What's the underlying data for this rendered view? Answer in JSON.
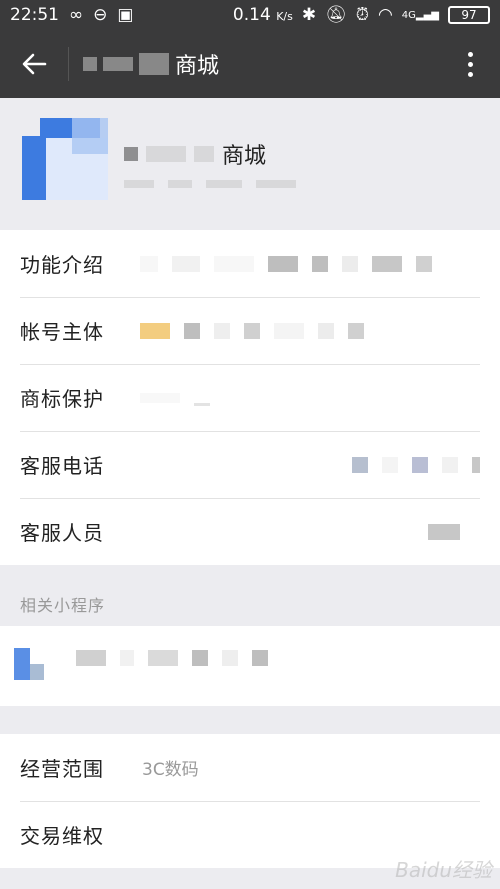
{
  "status_bar": {
    "time": "22:51",
    "speed": "0.14",
    "speed_unit": "K/s",
    "network": "4G",
    "battery": "97"
  },
  "app_bar": {
    "title": "商城"
  },
  "header": {
    "name": "商城"
  },
  "info_rows": [
    {
      "label": "功能介绍"
    },
    {
      "label": "帐号主体"
    },
    {
      "label": "商标保护"
    },
    {
      "label": "客服电话"
    },
    {
      "label": "客服人员"
    }
  ],
  "related_label": "相关小程序",
  "bottom_rows": [
    {
      "label": "经营范围",
      "value": "3C数码"
    },
    {
      "label": "交易维权",
      "value": ""
    }
  ],
  "watermark": "Baidu经验",
  "colors": {
    "bar": "#3a3a3b",
    "accent_blue": "#3d7be0",
    "background": "#ececf0"
  }
}
